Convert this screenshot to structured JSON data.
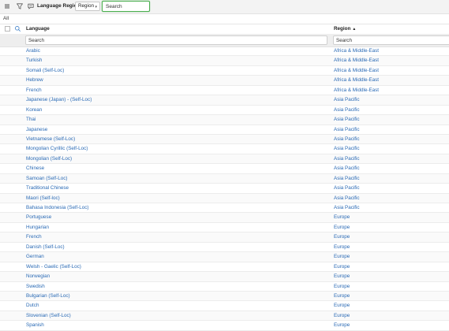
{
  "toolbar": {
    "title": "Language Regions",
    "field_select": "Region",
    "search_placeholder": "Search",
    "icons": [
      "hamburger-menu-icon",
      "filter-icon",
      "chat-icon"
    ]
  },
  "breadcrumb": "All",
  "table": {
    "columns": [
      {
        "label": "Language",
        "sort": ""
      },
      {
        "label": "Region",
        "sort": "ascending"
      }
    ],
    "filter_placeholders": [
      "Search",
      "Search"
    ],
    "rows": [
      {
        "language": "Arabic",
        "region": "Africa & Middle-East"
      },
      {
        "language": "Turkish",
        "region": "Africa & Middle-East"
      },
      {
        "language": "Somali (Self-Loc)",
        "region": "Africa & Middle-East"
      },
      {
        "language": "Hebrew",
        "region": "Africa & Middle-East"
      },
      {
        "language": "French",
        "region": "Africa & Middle-East"
      },
      {
        "language": "Japanese (Japan) - (Self-Loc)",
        "region": "Asia Pacific"
      },
      {
        "language": "Korean",
        "region": "Asia Pacific"
      },
      {
        "language": "Thai",
        "region": "Asia Pacific"
      },
      {
        "language": "Japanese",
        "region": "Asia Pacific"
      },
      {
        "language": "Vietnamese (Self-Loc)",
        "region": "Asia Pacific"
      },
      {
        "language": "Mongolian Cyrillic (Self-Loc)",
        "region": "Asia Pacific"
      },
      {
        "language": "Mongolian (Self-Loc)",
        "region": "Asia Pacific"
      },
      {
        "language": "Chinese",
        "region": "Asia Pacific"
      },
      {
        "language": "Samoan (Self-Loc)",
        "region": "Asia Pacific"
      },
      {
        "language": "Traditional Chinese",
        "region": "Asia Pacific"
      },
      {
        "language": "Maori (Self-loc)",
        "region": "Asia Pacific"
      },
      {
        "language": "Bahasa Indonesia (Self-Loc)",
        "region": "Asia Pacific"
      },
      {
        "language": "Portuguese",
        "region": "Europe"
      },
      {
        "language": "Hungarian",
        "region": "Europe"
      },
      {
        "language": "French",
        "region": "Europe"
      },
      {
        "language": "Danish (Self-Loc)",
        "region": "Europe"
      },
      {
        "language": "German",
        "region": "Europe"
      },
      {
        "language": "Welsh - Gaelic (Self-Loc)",
        "region": "Europe"
      },
      {
        "language": "Norwegian",
        "region": "Europe"
      },
      {
        "language": "Swedish",
        "region": "Europe"
      },
      {
        "language": "Bulgarian (Self-Loc)",
        "region": "Europe"
      },
      {
        "language": "Dutch",
        "region": "Europe"
      },
      {
        "language": "Slovenian (Self-Loc)",
        "region": "Europe"
      },
      {
        "language": "Spanish",
        "region": "Europe"
      }
    ]
  },
  "colors": {
    "link": "#2a6ab5",
    "focus_border": "#4caf50",
    "toolbar_bg": "#f3f3f3",
    "filter_row_bg": "#eeeeee"
  }
}
